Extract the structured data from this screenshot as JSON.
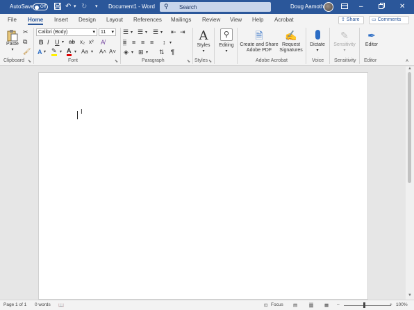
{
  "titlebar": {
    "autosave_label": "AutoSave",
    "autosave_state": "Off",
    "doc_title": "Document1 - Word",
    "search_placeholder": "Search",
    "user_name": "Doug Aamoth",
    "bg_color": "#2b579a"
  },
  "tabs": [
    "File",
    "Home",
    "Insert",
    "Design",
    "Layout",
    "References",
    "Mailings",
    "Review",
    "View",
    "Help",
    "Acrobat"
  ],
  "actions": {
    "share": "Share",
    "comments": "Comments"
  },
  "ribbon": {
    "clipboard": {
      "paste": "Paste",
      "label": "Clipboard"
    },
    "font": {
      "font_name": "Calibri (Body)",
      "font_size": "11",
      "label": "Font"
    },
    "paragraph": {
      "label": "Paragraph"
    },
    "styles": {
      "button": "Styles",
      "label": "Styles"
    },
    "editing": {
      "button": "Editing"
    },
    "acrobat": {
      "create_line1": "Create and Share",
      "create_line2": "Adobe PDF",
      "request_line1": "Request",
      "request_line2": "Signatures",
      "label": "Adobe Acrobat"
    },
    "voice": {
      "button": "Dictate",
      "label": "Voice"
    },
    "sensitivity": {
      "button": "Sensitivity",
      "label": "Sensitivity"
    },
    "editor": {
      "button": "Editor",
      "label": "Editor"
    }
  },
  "statusbar": {
    "page": "Page 1 of 1",
    "words": "0 words",
    "focus": "Focus",
    "zoom": "100%"
  }
}
